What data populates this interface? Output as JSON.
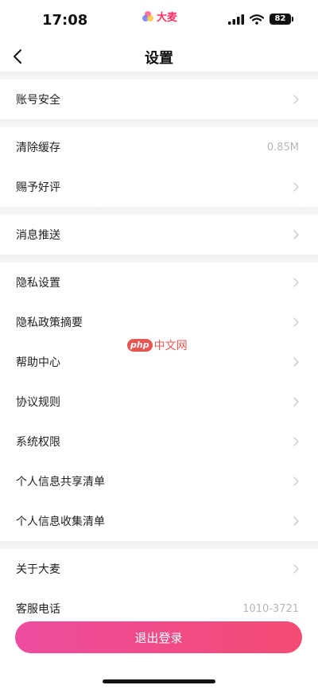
{
  "status_bar": {
    "time": "17:08",
    "brand": "大麦",
    "battery": "82"
  },
  "nav": {
    "title": "设置"
  },
  "groups": [
    [
      {
        "label": "账号安全",
        "value": ""
      }
    ],
    [
      {
        "label": "清除缓存",
        "value": "0.85M"
      },
      {
        "label": "赐予好评",
        "value": ""
      }
    ],
    [
      {
        "label": "消息推送",
        "value": ""
      }
    ],
    [
      {
        "label": "隐私设置",
        "value": ""
      },
      {
        "label": "隐私政策摘要",
        "value": ""
      },
      {
        "label": "帮助中心",
        "value": ""
      },
      {
        "label": "协议规则",
        "value": ""
      },
      {
        "label": "系统权限",
        "value": ""
      },
      {
        "label": "个人信息共享清单",
        "value": ""
      },
      {
        "label": "个人信息收集清单",
        "value": ""
      }
    ],
    [
      {
        "label": "关于大麦",
        "value": ""
      },
      {
        "label": "客服电话",
        "value": "1010-3721"
      }
    ]
  ],
  "logout_label": "退出登录",
  "watermark": {
    "badge": "php",
    "text": "中文网"
  }
}
